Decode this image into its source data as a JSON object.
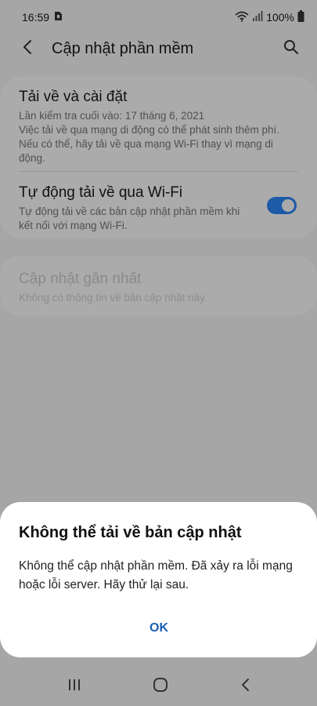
{
  "status_bar": {
    "time": "16:59",
    "battery_percent": "100%",
    "icons": [
      "sim-icon",
      "wifi-icon",
      "signal-icon",
      "battery-icon"
    ]
  },
  "app_bar": {
    "title": "Cập nhật phần mềm",
    "back_icon": "chevron-left-icon",
    "search_icon": "search-icon"
  },
  "settings": {
    "download_install": {
      "title": "Tải về và cài đặt",
      "last_checked": "Lần kiểm tra cuối vào: 17 tháng 6, 2021",
      "description": "Việc tải về qua mạng di động có thể phát sinh thêm phí. Nếu có thể, hãy tải về qua mạng Wi-Fi thay vì mạng di động."
    },
    "auto_wifi": {
      "title": "Tự động tải về qua Wi-Fi",
      "description": "Tự động tải về các bản cập nhật phần mềm khi kết nối với mạng Wi-Fi.",
      "enabled": true
    },
    "last_update": {
      "title": "Cập nhật gần nhất",
      "description": "Không có thông tin về bản cập nhật này."
    }
  },
  "dialog": {
    "title": "Không thể tải về bản cập nhật",
    "message": "Không thể cập nhật phần mềm. Đã xảy ra lỗi mạng hoặc lỗi server. Hãy thử lại sau.",
    "ok_label": "OK"
  },
  "nav_bar": {
    "icons": [
      "recent-apps-icon",
      "home-icon",
      "back-icon"
    ]
  },
  "colors": {
    "accent": "#1a5fb4",
    "toggle": "#1e5aa8",
    "overlay_bg": "#a6a6a6"
  }
}
